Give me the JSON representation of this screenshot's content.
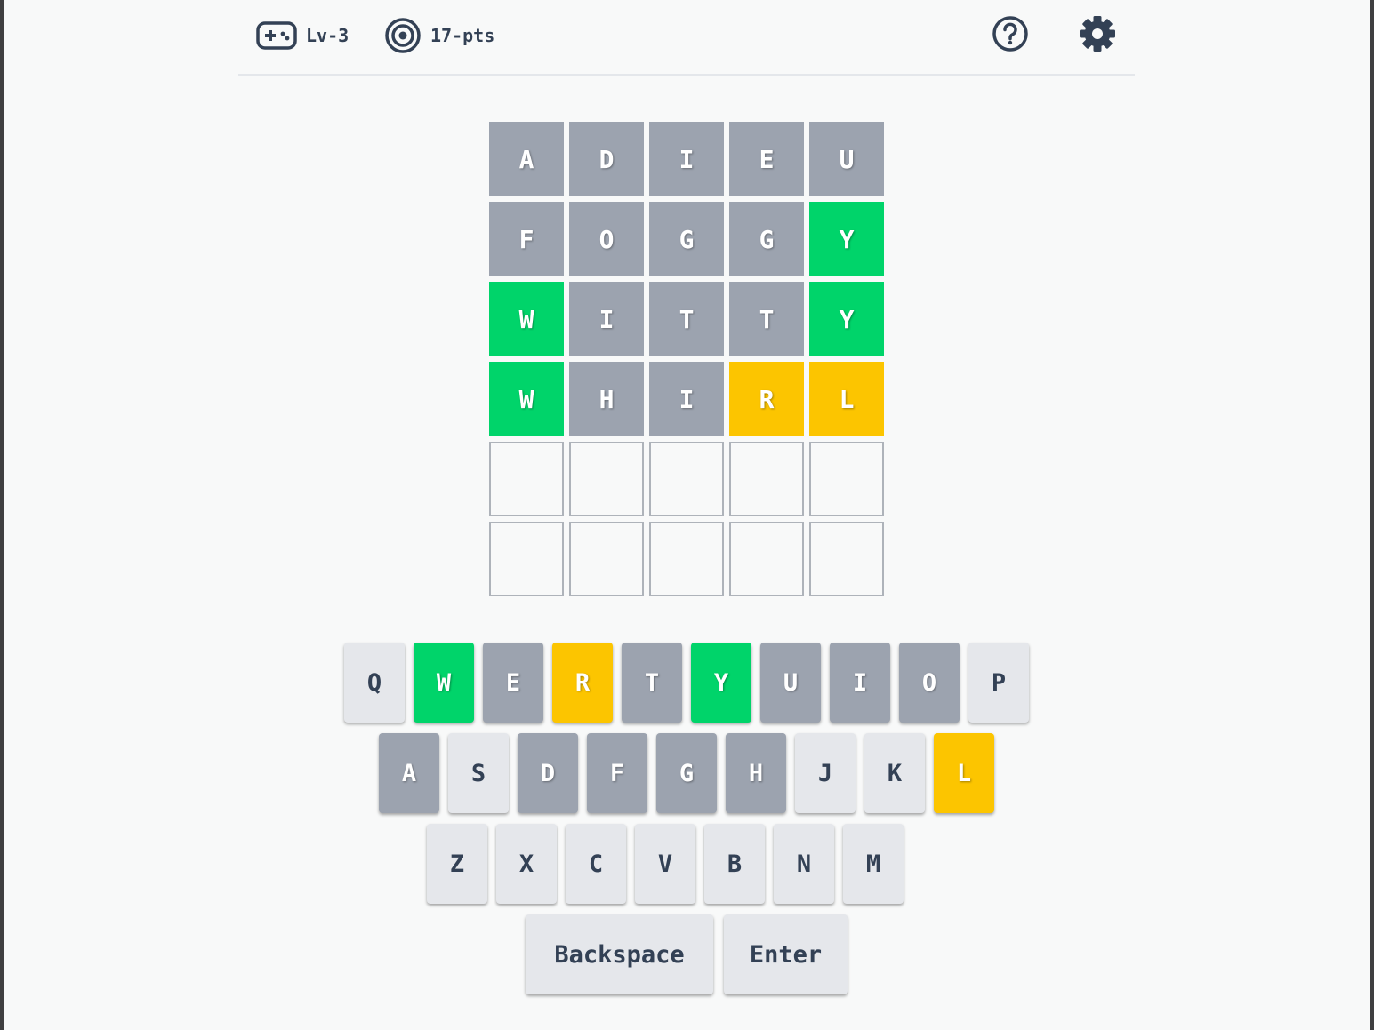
{
  "header": {
    "level_label": "Lv-3",
    "points_label": "17-pts",
    "level_icon": "gamepad-icon",
    "points_icon": "target-icon",
    "help_icon": "help-circle-icon",
    "settings_icon": "gear-icon"
  },
  "colors": {
    "correct": "#00d46a",
    "present": "#fcc500",
    "absent": "#9ca3af",
    "key_default": "#e5e7eb",
    "text_dark": "#334155"
  },
  "board": {
    "rows": [
      {
        "tiles": [
          {
            "letter": "A",
            "state": "absent"
          },
          {
            "letter": "D",
            "state": "absent"
          },
          {
            "letter": "I",
            "state": "absent"
          },
          {
            "letter": "E",
            "state": "absent"
          },
          {
            "letter": "U",
            "state": "absent"
          }
        ]
      },
      {
        "tiles": [
          {
            "letter": "F",
            "state": "absent"
          },
          {
            "letter": "O",
            "state": "absent"
          },
          {
            "letter": "G",
            "state": "absent"
          },
          {
            "letter": "G",
            "state": "absent"
          },
          {
            "letter": "Y",
            "state": "correct"
          }
        ]
      },
      {
        "tiles": [
          {
            "letter": "W",
            "state": "correct"
          },
          {
            "letter": "I",
            "state": "absent"
          },
          {
            "letter": "T",
            "state": "absent"
          },
          {
            "letter": "T",
            "state": "absent"
          },
          {
            "letter": "Y",
            "state": "correct"
          }
        ]
      },
      {
        "tiles": [
          {
            "letter": "W",
            "state": "correct"
          },
          {
            "letter": "H",
            "state": "absent"
          },
          {
            "letter": "I",
            "state": "absent"
          },
          {
            "letter": "R",
            "state": "present"
          },
          {
            "letter": "L",
            "state": "present"
          }
        ]
      },
      {
        "tiles": [
          {
            "letter": "",
            "state": "empty"
          },
          {
            "letter": "",
            "state": "empty"
          },
          {
            "letter": "",
            "state": "empty"
          },
          {
            "letter": "",
            "state": "empty"
          },
          {
            "letter": "",
            "state": "empty"
          }
        ]
      },
      {
        "tiles": [
          {
            "letter": "",
            "state": "empty"
          },
          {
            "letter": "",
            "state": "empty"
          },
          {
            "letter": "",
            "state": "empty"
          },
          {
            "letter": "",
            "state": "empty"
          },
          {
            "letter": "",
            "state": "empty"
          }
        ]
      }
    ]
  },
  "keyboard": {
    "row1": [
      {
        "label": "Q",
        "state": "default"
      },
      {
        "label": "W",
        "state": "correct"
      },
      {
        "label": "E",
        "state": "absent"
      },
      {
        "label": "R",
        "state": "present"
      },
      {
        "label": "T",
        "state": "absent"
      },
      {
        "label": "Y",
        "state": "correct"
      },
      {
        "label": "U",
        "state": "absent"
      },
      {
        "label": "I",
        "state": "absent"
      },
      {
        "label": "O",
        "state": "absent"
      },
      {
        "label": "P",
        "state": "default"
      }
    ],
    "row2": [
      {
        "label": "A",
        "state": "absent"
      },
      {
        "label": "S",
        "state": "default"
      },
      {
        "label": "D",
        "state": "absent"
      },
      {
        "label": "F",
        "state": "absent"
      },
      {
        "label": "G",
        "state": "absent"
      },
      {
        "label": "H",
        "state": "absent"
      },
      {
        "label": "J",
        "state": "default"
      },
      {
        "label": "K",
        "state": "default"
      },
      {
        "label": "L",
        "state": "present"
      }
    ],
    "row3": [
      {
        "label": "Z",
        "state": "default"
      },
      {
        "label": "X",
        "state": "default"
      },
      {
        "label": "C",
        "state": "default"
      },
      {
        "label": "V",
        "state": "default"
      },
      {
        "label": "B",
        "state": "default"
      },
      {
        "label": "N",
        "state": "default"
      },
      {
        "label": "M",
        "state": "default"
      }
    ],
    "backspace_label": "Backspace",
    "enter_label": "Enter"
  }
}
